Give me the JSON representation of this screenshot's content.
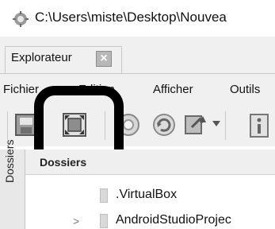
{
  "window": {
    "title": "C:\\Users\\miste\\Desktop\\Nouvea"
  },
  "tabs": [
    {
      "label": "Explorateur",
      "close_label": "×"
    }
  ],
  "menu": {
    "items": [
      {
        "label": "Fichier"
      },
      {
        "label": "Edition"
      },
      {
        "label": "Afficher"
      },
      {
        "label": "Outils"
      }
    ]
  },
  "toolbar": {
    "icons": [
      "save-view-icon",
      "fullscreen-icon",
      "back-icon",
      "refresh-icon",
      "transfer-icon",
      "dropdown-icon",
      "info-icon"
    ]
  },
  "side_panel": {
    "label": "Dossiers"
  },
  "tree": {
    "header_label": "Dossiers",
    "items": [
      {
        "label": ".VirtualBox",
        "has_children": false
      },
      {
        "label": "AndroidStudioProjec",
        "has_children": true,
        "expander": ">"
      }
    ]
  },
  "colors": {
    "chrome_background": "#f0f0f0",
    "highlight_border": "#000000"
  }
}
